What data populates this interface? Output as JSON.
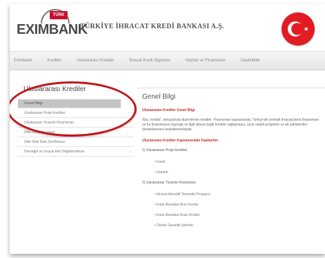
{
  "header": {
    "logo_tag": "TÜRK",
    "logo_text": "EXIMBANK",
    "bank_name": "TÜRKİYE İHRACAT KREDİ BANKASI A.Ş."
  },
  "colors": {
    "brand_red": "#c8102e",
    "flag_red": "#e11c23",
    "highlight": "#c0141b"
  },
  "nav": {
    "items": [
      "Eximbank",
      "Krediler",
      "Uluslararası Krediler",
      "İhracat Kredi Sigortası",
      "Hazine ve Finansman",
      "İstatistikler"
    ]
  },
  "sidebar": {
    "title": "Uluslararası Krediler",
    "items": [
      {
        "label": "Genel Bilgi",
        "active": true,
        "arrow": ""
      },
      {
        "label": "Uluslararası Proje Kredileri",
        "active": false,
        "arrow": ""
      },
      {
        "label": "Uluslararası Ticarete Finansman",
        "active": false,
        "arrow": "›"
      },
      {
        "label": "Ülke Limitleri Listesi",
        "active": false,
        "arrow": ""
      },
      {
        "label": "Ülke Risk Notu Sınıflaması",
        "active": false,
        "arrow": ""
      },
      {
        "label": "Derneğin ve Sosyal Etki Değerlendirme",
        "active": false,
        "arrow": "›"
      }
    ]
  },
  "main": {
    "title": "Genel Bilgi",
    "heading1": "Uluslararası Krediler Genel Bilgi",
    "paragraph": "'Ekz. kredisi', amaçlarıyla düzenlenen krediler. Finansman kapsamında, Türkiye'de yerleşik ihracatçıların finansmanı ve bu finansmanın kaynağı ve ilgili ülkeye bağlı krediler sağlanması, uzun vadeli projelerin ve alt yüklenicileri desteklenmesi hedeflenmektedir.",
    "heading2": "Uluslararası Krediler Kapsamındaki Faaliyetler",
    "section1": "1) Uluslararası Proje Kredileri",
    "section1_items": [
      "Kredi",
      "Garanti"
    ],
    "section2": "2) Uluslararası Ticarete Finansman",
    "section2_items": [
      "İhracat Akreditif Teminatlı Programı",
      "Kutlu Bankalar Alım Kredisi",
      "Kutlu Bankalar Arası Kredisi",
      "Devlet Garantili İşlemler"
    ]
  }
}
